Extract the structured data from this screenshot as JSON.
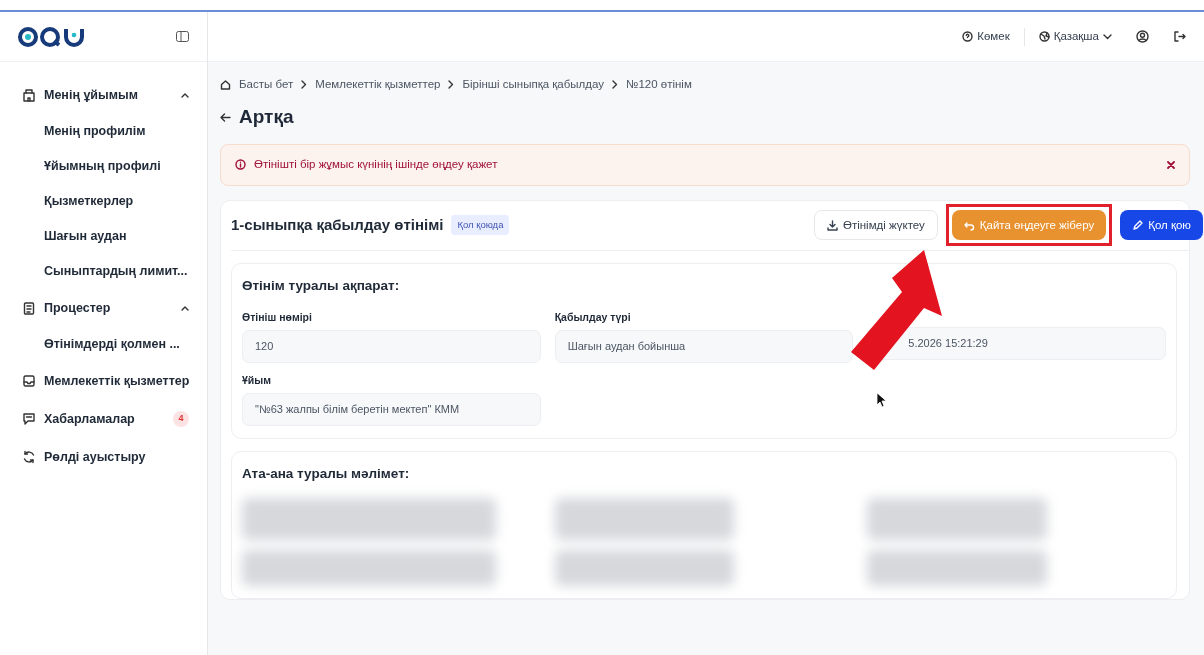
{
  "header": {
    "help": "Көмек",
    "language": "Қазақша"
  },
  "sidebar": {
    "items": [
      {
        "label": "Менің ұйымым",
        "expanded": true,
        "children": [
          {
            "label": "Менің профилім"
          },
          {
            "label": "Ұйымның профилі"
          },
          {
            "label": "Қызметкерлер"
          },
          {
            "label": "Шағын аудан"
          },
          {
            "label": "Сыныптардың лимит..."
          }
        ]
      },
      {
        "label": "Процестер",
        "expanded": true,
        "children": [
          {
            "label": "Өтінімдерді қолмен ..."
          }
        ]
      },
      {
        "label": "Мемлекеттік қызметтер"
      },
      {
        "label": "Хабарламалар",
        "badge": "4"
      },
      {
        "label": "Рөлді ауыстыру"
      }
    ]
  },
  "breadcrumbs": [
    "Басты бет",
    "Мемлекеттік қызметтер",
    "Бірінші сыныпқа қабылдау",
    "№120 өтінім"
  ],
  "back": "Артқа",
  "alert": {
    "text": "Өтінішті бір жұмыс күнінің ішінде өңдеу қажет"
  },
  "application": {
    "title": "1-сыныпқа қабылдау өтінімі",
    "status": "Қол қоюда",
    "buttons": [
      {
        "label": "Өтінімді жүктеу",
        "kind": "outline",
        "highlighted": false
      },
      {
        "label": "Қайта өңдеуге жіберу",
        "kind": "warning",
        "highlighted": true
      },
      {
        "label": "Қол қою",
        "kind": "primary",
        "highlighted": false
      }
    ],
    "info": {
      "title": "Өтінім туралы ақпарат:",
      "fields": [
        {
          "label": "Өтініш нөмірі",
          "value": "120"
        },
        {
          "label": "Қабылдау түрі",
          "value": "Шағын аудан бойынша"
        },
        {
          "value": "5.2026 15:21:29"
        },
        {
          "label": "Ұйым",
          "value": "\"№63 жалпы білім беретін мектеп\" КММ"
        }
      ]
    },
    "parents": {
      "title": "Ата-ана туралы мәлімет:"
    }
  }
}
